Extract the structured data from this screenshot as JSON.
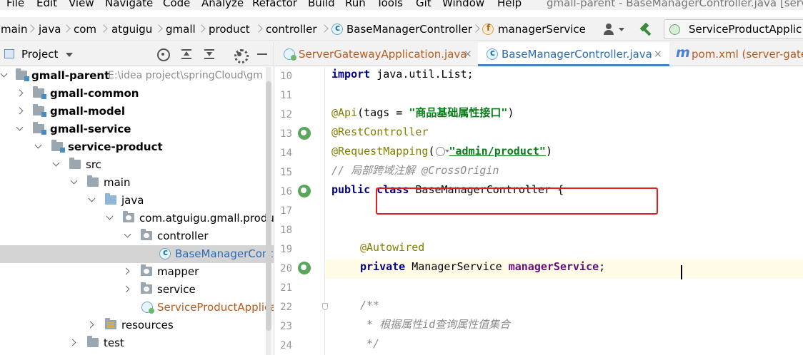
{
  "menu": {
    "items": [
      "File",
      "Edit",
      "View",
      "Navigate",
      "Code",
      "Analyze",
      "Refactor",
      "Build",
      "Run",
      "Tools",
      "Git",
      "Window",
      "Help"
    ],
    "window_title": "gmall-parent - BaseManagerController.java [servic"
  },
  "nav": {
    "breadcrumbs": [
      "main",
      "java",
      "com",
      "atguigu",
      "gmall",
      "product",
      "controller",
      "BaseManagerController",
      "managerService"
    ],
    "run_config": "ServiceProductApplic"
  },
  "project": {
    "title": "Project",
    "tree": [
      {
        "label": "gmall-parent",
        "path": "E:\\idea project\\springCloud\\gm"
      },
      {
        "label": "gmall-common"
      },
      {
        "label": "gmall-model"
      },
      {
        "label": "gmall-service"
      },
      {
        "label": "service-product"
      },
      {
        "label": "src"
      },
      {
        "label": "main"
      },
      {
        "label": "java"
      },
      {
        "label": "com.atguigu.gmall.produc"
      },
      {
        "label": "controller"
      },
      {
        "label": "BaseManagerContr"
      },
      {
        "label": "mapper"
      },
      {
        "label": "service"
      },
      {
        "label": "ServiceProductApplica"
      },
      {
        "label": "resources"
      },
      {
        "label": "test"
      }
    ]
  },
  "tabs": [
    {
      "label": "ServerGatewayApplication.java",
      "close": "×"
    },
    {
      "label": "BaseManagerController.java",
      "close": "×"
    },
    {
      "label": "pom.xml (server-gate"
    }
  ],
  "colors": {
    "keyword": "#000080",
    "annotation": "#808000",
    "string": "#067d17",
    "comment": "#8c8c8c",
    "field": "#660e7a",
    "highlight_box": "#e02020",
    "selection": "#d4d4d4",
    "current_line": "#fffbe6"
  },
  "code": {
    "line_numbers": [
      "10",
      "11",
      "12",
      "13",
      "14",
      "15",
      "16",
      "17",
      "18",
      "19",
      "20",
      "21",
      "22",
      "23",
      "24"
    ],
    "l10": {
      "kw": "import",
      "rest": " java.util.List;"
    },
    "l12": {
      "ann": "@Api",
      "mid": "(tags = ",
      "str": "\"商品基础属性接口\"",
      "end": ")"
    },
    "l13": {
      "ann": "@RestController"
    },
    "l14": {
      "ann": "@RequestMapping",
      "open": "(",
      "str": "\"admin/product\"",
      "end": ")"
    },
    "l15": {
      "cm": "// 局部跨域注解 @CrossOrigin"
    },
    "l16": {
      "kw1": "public",
      "kw2": "class",
      "rest": " BaseManagerController {"
    },
    "l19": {
      "ann": "@Autowired"
    },
    "l20": {
      "kw": "private",
      "type": " ManagerService ",
      "fld": "managerService",
      "end": ";"
    },
    "l22": {
      "cm": "/**"
    },
    "l23": {
      "cm": " * 根据属性id查询属性值集合"
    },
    "l24": {
      "cm": " */"
    }
  }
}
